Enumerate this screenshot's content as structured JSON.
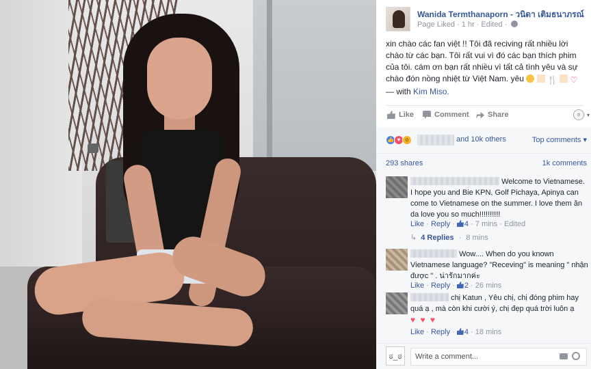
{
  "page": {
    "name": "Wanida Termthanaporn - วนิดา เติมธนาภรณ์",
    "meta_liked": "Page Liked",
    "meta_time": "1 hr",
    "meta_edited": "Edited"
  },
  "post": {
    "text_main": "xin chào các fan việt !! Tôi đã reciving rất nhiều lời chào từ các bạn. Tôi rất vui vì đó các bạn thích phim của tôi. cám ơn bạn rất nhiều vì tất cả tình yêu và sự chào đón nồng nhiệt từ Việt Nam. yêu",
    "with_prefix": "— with",
    "with_name": "Kim Miso."
  },
  "actions": {
    "like": "Like",
    "comment": "Comment",
    "share": "Share"
  },
  "reactions": {
    "others": "and 10k others",
    "top_comments": "Top comments ▾"
  },
  "counts": {
    "shares": "293 shares",
    "comments": "1k comments"
  },
  "comments": [
    {
      "text": "Welcome to Vietnamese. I hope you and Bie KPN, Golf Pichaya, Apinya can come to Vietnamese on the summer. I love them ăn da love you so much!!!!!!!!!!",
      "like": "Like",
      "reply": "Reply",
      "likes": "4",
      "time": "7 mins",
      "edited": "Edited"
    },
    {
      "text": "Wow.... When do you known Vietnamese language? \"Receving\" is meaning \" nhận được \" . น่ารักมากค่ะ",
      "like": "Like",
      "reply": "Reply",
      "likes": "2",
      "time": "26 mins"
    },
    {
      "text": "chị Katun , Yêu chị, chị đóng phim hay quá ạ , mà còn khi cười ý, chị đẹp quá trời luôn ạ",
      "hearts": "♥ ♥ ♥",
      "like": "Like",
      "reply": "Reply",
      "likes": "4",
      "time": "18 mins"
    }
  ],
  "replies": {
    "label": "4 Replies",
    "time": "8 mins"
  },
  "write": {
    "placeholder": "Write a comment..."
  }
}
